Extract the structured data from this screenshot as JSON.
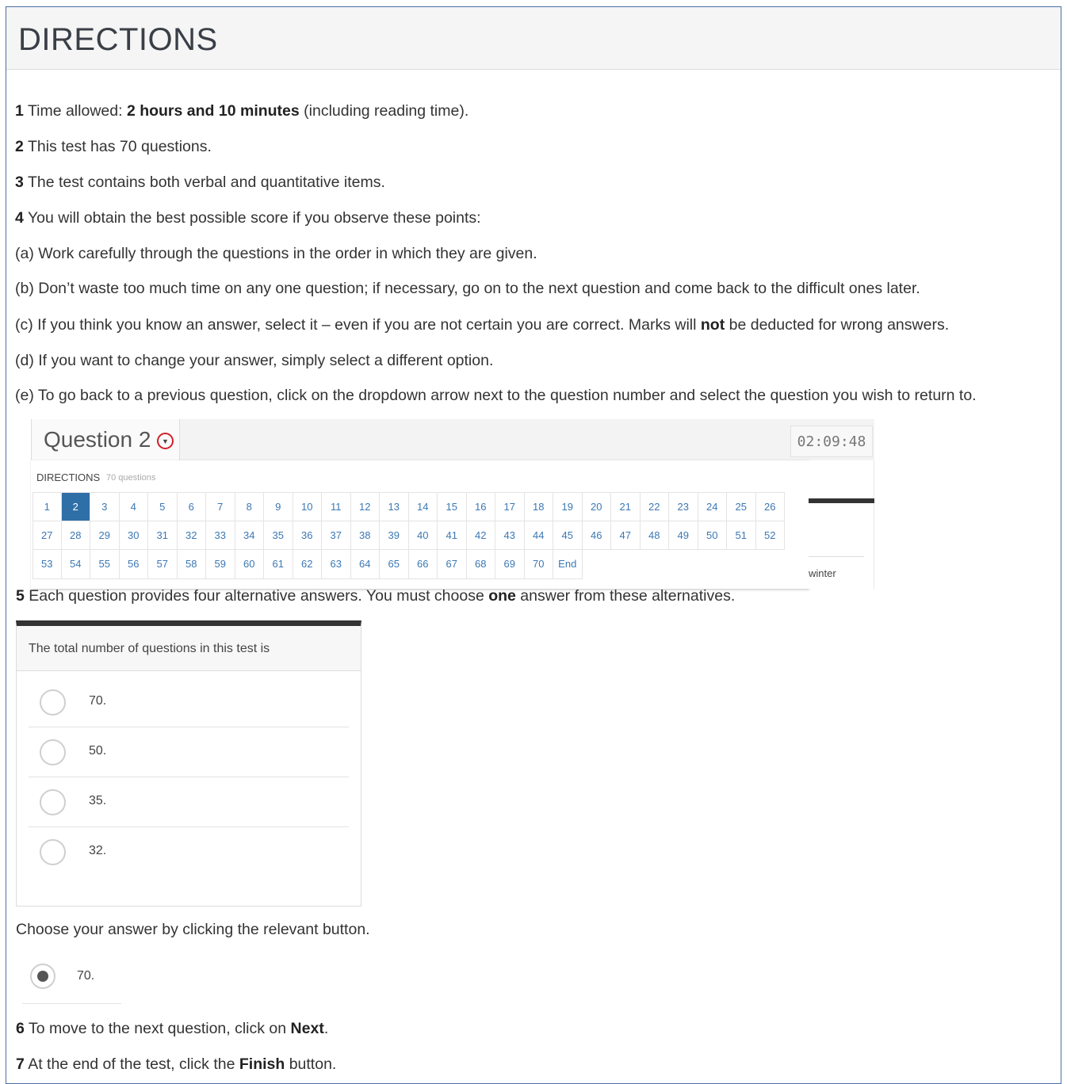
{
  "title": "DIRECTIONS",
  "items": {
    "i1": {
      "num": "1",
      "pre": "Time allowed: ",
      "bold": "2 hours and 10 minutes",
      "post": " (including reading time)."
    },
    "i2": {
      "num": "2",
      "text": "This test has 70 questions."
    },
    "i3": {
      "num": "3",
      "text": "The test contains both verbal and quantitative items."
    },
    "i4": {
      "num": "4",
      "text": "You will obtain the best possible score if you observe these points:"
    },
    "a": "(a) Work carefully through the questions in the order in which they are given.",
    "b": "(b) Don’t waste too much time on any one question; if necessary, go on to the next question and come back to the difficult ones later.",
    "c": {
      "pre": "(c) If you think you know an answer, select it – even if you are not certain you are correct. Marks will ",
      "bold": "not",
      "post": " be deducted for wrong answers."
    },
    "d": "(d) If you want to change your answer, simply select a different option.",
    "e": "(e) To go back to a previous question, click on the dropdown arrow next to the question number and select the question you wish to return to.",
    "i5": {
      "num": "5",
      "pre": "Each question provides four alternative answers. You must choose ",
      "bold": "one",
      "post": " answer from these alternatives."
    },
    "choose": "Choose your answer by clicking the relevant button.",
    "i6": {
      "num": "6",
      "pre": "To move to the next question, click on ",
      "bold": "Next",
      "post": "."
    },
    "i7": {
      "num": "7",
      "pre": "At the end of the test, click the ",
      "bold": "Finish",
      "post": " button."
    }
  },
  "example_nav": {
    "question_title": "Question 2",
    "dropdown_icon": "chevron-down-circle-icon",
    "timer": "02:09:48",
    "section_label": "DIRECTIONS",
    "section_count": "70 questions",
    "active": "2",
    "numbers": [
      "1",
      "2",
      "3",
      "4",
      "5",
      "6",
      "7",
      "8",
      "9",
      "10",
      "11",
      "12",
      "13",
      "14",
      "15",
      "16",
      "17",
      "18",
      "19",
      "20",
      "21",
      "22",
      "23",
      "24",
      "25",
      "26",
      "27",
      "28",
      "29",
      "30",
      "31",
      "32",
      "33",
      "34",
      "35",
      "36",
      "37",
      "38",
      "39",
      "40",
      "41",
      "42",
      "43",
      "44",
      "45",
      "46",
      "47",
      "48",
      "49",
      "50",
      "51",
      "52",
      "53",
      "54",
      "55",
      "56",
      "57",
      "58",
      "59",
      "60",
      "61",
      "62",
      "63",
      "64",
      "65",
      "66",
      "67",
      "68",
      "69",
      "70",
      "End"
    ],
    "side_text": "winter",
    "active_color": "#2f6fa8",
    "link_color": "#3c78b4"
  },
  "example_question": {
    "prompt": "The total number of questions in this test is",
    "options": [
      "70.",
      "50.",
      "35.",
      "32."
    ]
  },
  "example_selected": {
    "label": "70."
  }
}
